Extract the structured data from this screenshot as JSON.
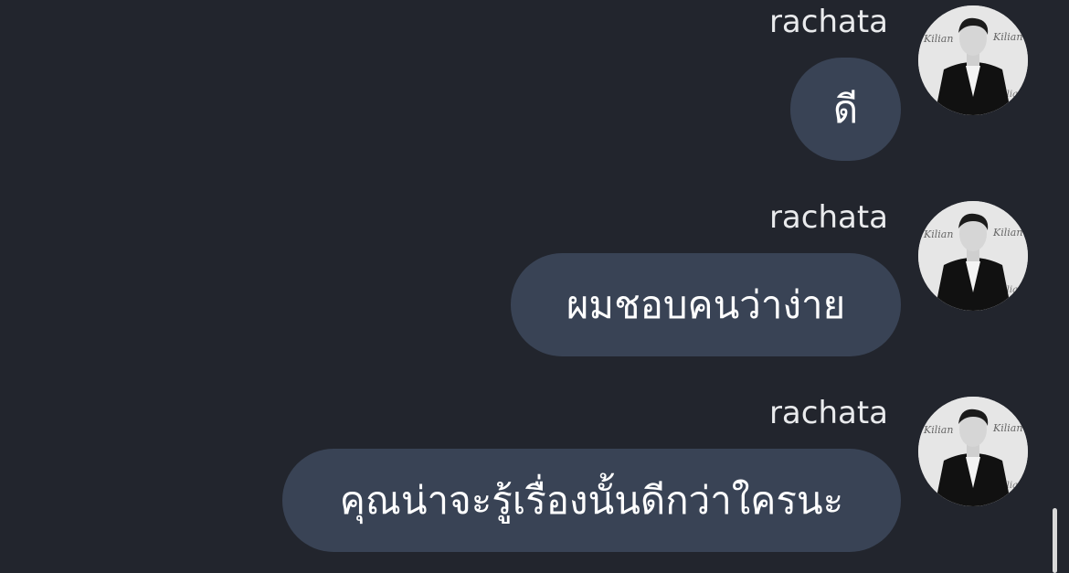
{
  "messages": [
    {
      "sender": "rachata",
      "text": "ดี"
    },
    {
      "sender": "rachata",
      "text": "ผมชอบคนว่าง่าย"
    },
    {
      "sender": "rachata",
      "text": "คุณน่าจะรู้เรื่องนั้นดีกว่าใครนะ"
    }
  ],
  "colors": {
    "background": "#22252d",
    "bubble": "#394355",
    "text": "#ffffff"
  },
  "icons": {
    "avatar": "user-avatar-photo"
  }
}
